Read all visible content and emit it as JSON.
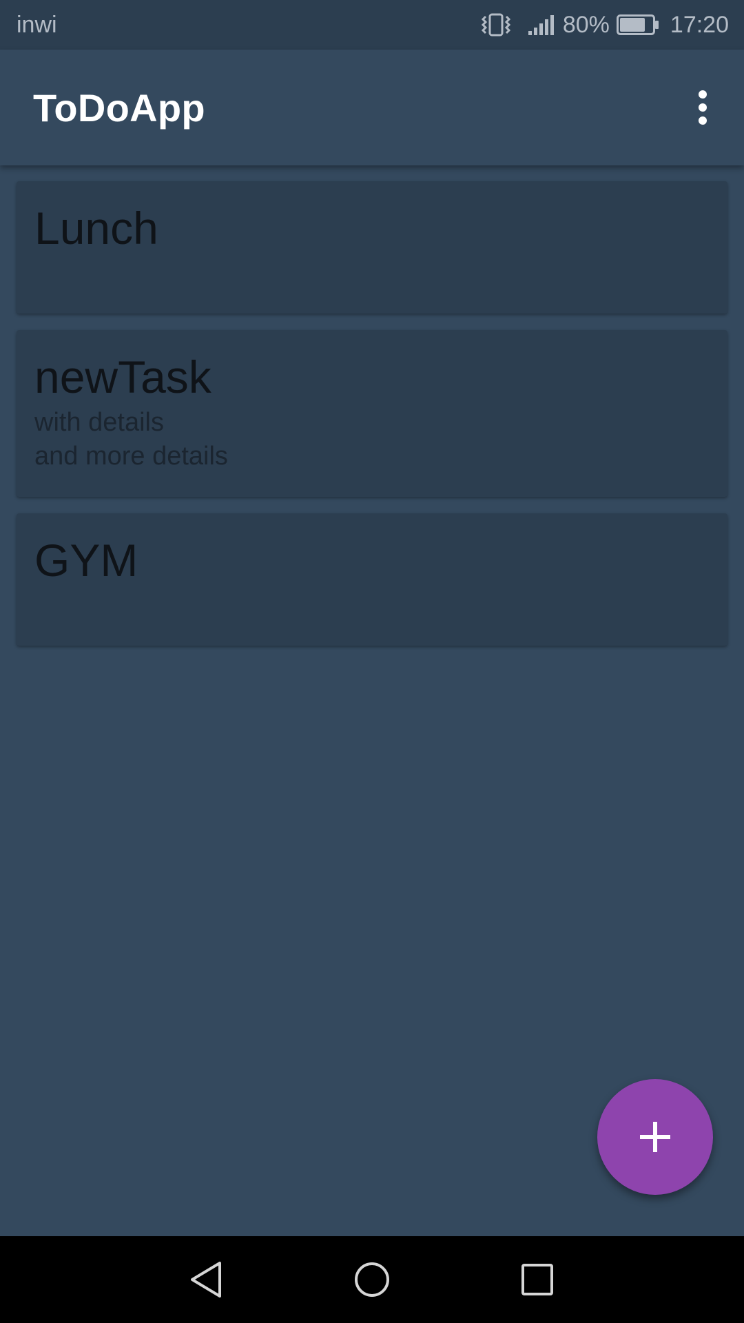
{
  "status_bar": {
    "carrier": "inwi",
    "battery_percent_text": "80%",
    "battery_level": 0.8,
    "time": "17:20",
    "icons": [
      "vibrate-icon",
      "signal-icon",
      "battery-icon"
    ]
  },
  "app_bar": {
    "title": "ToDoApp",
    "menu_icon": "more-vert-icon"
  },
  "tasks": [
    {
      "title": "Lunch",
      "details": ""
    },
    {
      "title": "newTask",
      "details": "with details\nand more details"
    },
    {
      "title": "GYM",
      "details": ""
    }
  ],
  "fab": {
    "icon": "add-icon",
    "color": "#8e44ad"
  },
  "nav_bar": {
    "icons": [
      "back-icon",
      "home-icon",
      "recents-icon"
    ]
  },
  "colors": {
    "background": "#34495e",
    "status_bar": "#2c3e50",
    "card": "#2c3e50",
    "accent": "#8e44ad"
  }
}
